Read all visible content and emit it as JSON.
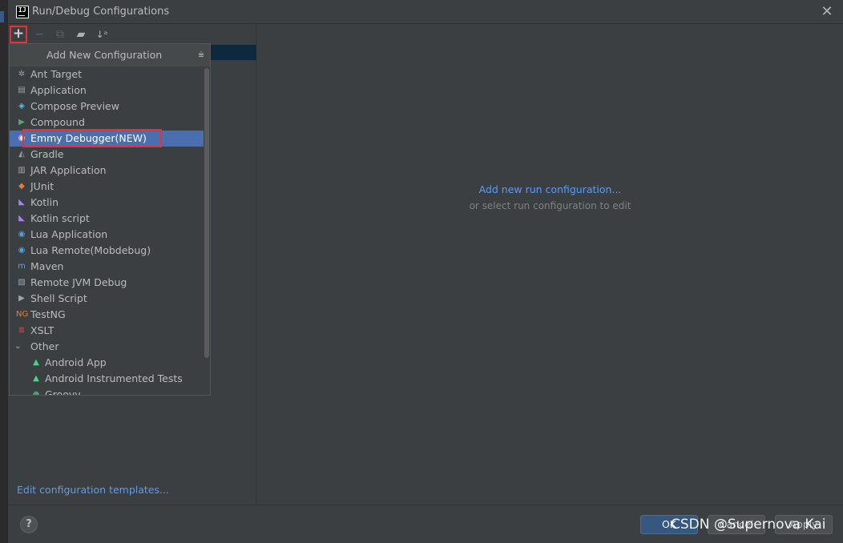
{
  "window": {
    "title": "Run/Debug Configurations",
    "app_icon_text": "IJ"
  },
  "toolbar": {
    "add_glyph": "+",
    "remove_glyph": "−",
    "copy_glyph": "⧉",
    "folder_glyph": "▰",
    "sort_glyph": "↓ᵃ"
  },
  "popup": {
    "title": "Add New Configuration",
    "items": [
      {
        "label": "Ant Target",
        "icon": "ant-icon",
        "glyph": "✲",
        "color": "#9aa0a6"
      },
      {
        "label": "Application",
        "icon": "application-icon",
        "glyph": "▤",
        "color": "#9aa7b0"
      },
      {
        "label": "Compose Preview",
        "icon": "compose-icon",
        "glyph": "◈",
        "color": "#4fc3f7"
      },
      {
        "label": "Compound",
        "icon": "compound-icon",
        "glyph": "▶",
        "color": "#59a869"
      },
      {
        "label": "Emmy Debugger(NEW)",
        "icon": "emmy-lua-icon",
        "glyph": "◉",
        "color": "#e8e8e8",
        "selected": true
      },
      {
        "label": "Gradle",
        "icon": "gradle-icon",
        "glyph": "◭",
        "color": "#9aa0a6"
      },
      {
        "label": "JAR Application",
        "icon": "jar-icon",
        "glyph": "▥",
        "color": "#9aa7b0"
      },
      {
        "label": "JUnit",
        "icon": "junit-icon",
        "glyph": "◆",
        "color": "#e57c3b"
      },
      {
        "label": "Kotlin",
        "icon": "kotlin-icon",
        "glyph": "◣",
        "color": "#a97bff"
      },
      {
        "label": "Kotlin script",
        "icon": "kotlin-script-icon",
        "glyph": "◣",
        "color": "#a97bff"
      },
      {
        "label": "Lua Application",
        "icon": "lua-icon",
        "glyph": "◉",
        "color": "#4fa3e0"
      },
      {
        "label": "Lua Remote(Mobdebug)",
        "icon": "lua-remote-icon",
        "glyph": "◉",
        "color": "#4fa3e0"
      },
      {
        "label": "Maven",
        "icon": "maven-icon",
        "glyph": "m",
        "color": "#6a9fd8"
      },
      {
        "label": "Remote JVM Debug",
        "icon": "remote-debug-icon",
        "glyph": "▧",
        "color": "#9aa7b0"
      },
      {
        "label": "Shell Script",
        "icon": "shell-icon",
        "glyph": "▶",
        "color": "#9aa7b0"
      },
      {
        "label": "TestNG",
        "icon": "testng-icon",
        "glyph": "NG",
        "color": "#e57c3b"
      },
      {
        "label": "XSLT",
        "icon": "xslt-icon",
        "glyph": "≣",
        "color": "#c75450"
      }
    ],
    "group": {
      "label": "Other",
      "chevron": "⌄"
    },
    "children": [
      {
        "label": "Android App",
        "icon": "android-icon",
        "glyph": "▲",
        "color": "#3ddc84"
      },
      {
        "label": "Android Instrumented Tests",
        "icon": "android-test-icon",
        "glyph": "▲",
        "color": "#3ddc84"
      },
      {
        "label": "Groovy",
        "icon": "groovy-icon",
        "glyph": "●",
        "color": "#4f9a6e"
      }
    ],
    "pin_glyph": "⩧"
  },
  "left": {
    "edit_templates": "Edit configuration templates..."
  },
  "right": {
    "add_link": "Add new run configuration...",
    "hint": "or select run configuration to edit"
  },
  "footer": {
    "help": "?",
    "ok": "OK",
    "cancel": "Cancel",
    "apply": "Apply",
    "watermark": "CSDN @Supernova Kai"
  },
  "colors": {
    "accent_red": "#e2333b",
    "selection": "#4b6eaf",
    "link": "#589df6"
  }
}
